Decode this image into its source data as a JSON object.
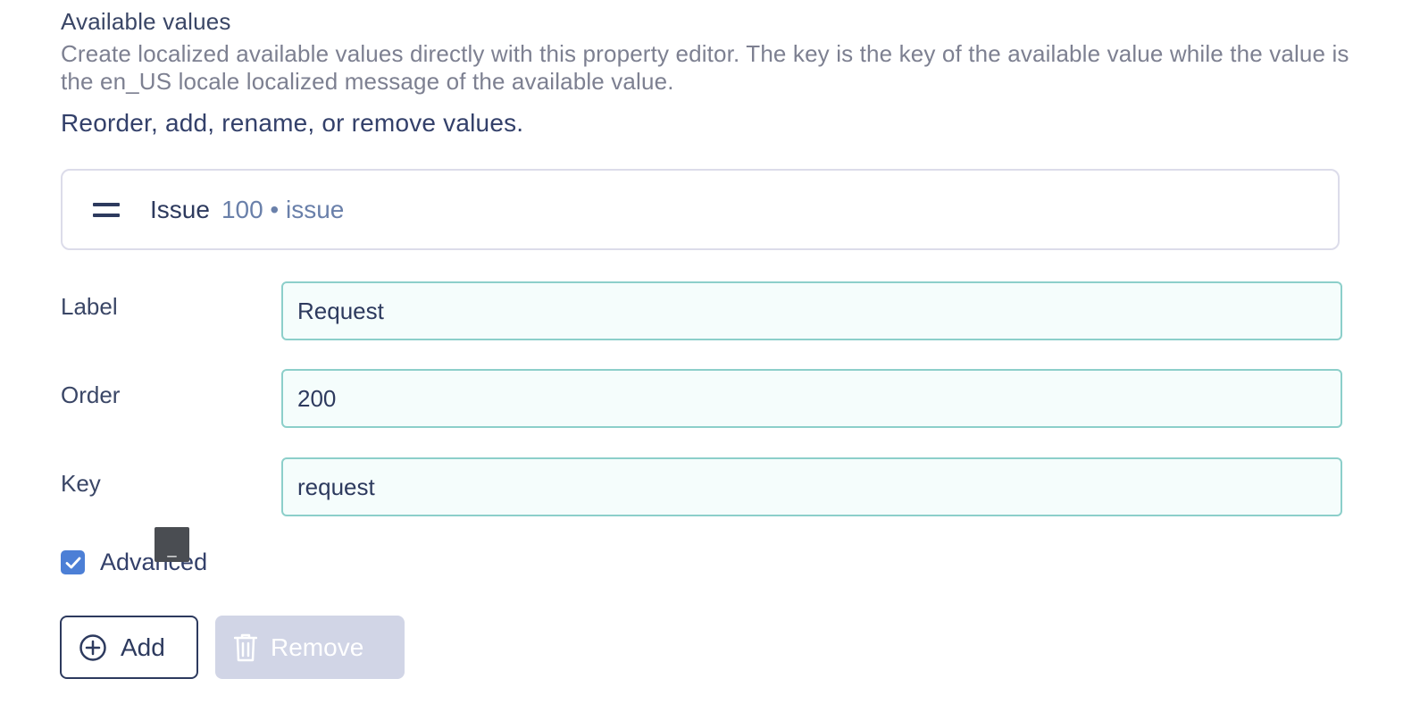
{
  "section": {
    "title": "Available values",
    "description": "Create localized available values directly with this property editor. The key is the key of the available value while the value is the en_US locale localized message of the available value.",
    "instructions": "Reorder, add, rename, or remove values."
  },
  "value_item": {
    "label": "Issue",
    "meta": "100 • issue"
  },
  "form": {
    "label_field": {
      "label": "Label",
      "value": "Request"
    },
    "order_field": {
      "label": "Order",
      "value": "200"
    },
    "key_field": {
      "label": "Key",
      "value": "request"
    },
    "advanced": {
      "label": "Advanced",
      "checked": true
    }
  },
  "tooltip": {
    "text": "_"
  },
  "actions": {
    "add_label": "Add",
    "remove_label": "Remove",
    "remove_disabled": true
  },
  "colors": {
    "primary": "#2d3a5e",
    "checkbox": "#4c7fd6",
    "input_border": "#8ccfca",
    "input_bg": "#f5fdfc",
    "disabled_button": "#d1d5e6",
    "meta_text": "#6a80aa"
  }
}
